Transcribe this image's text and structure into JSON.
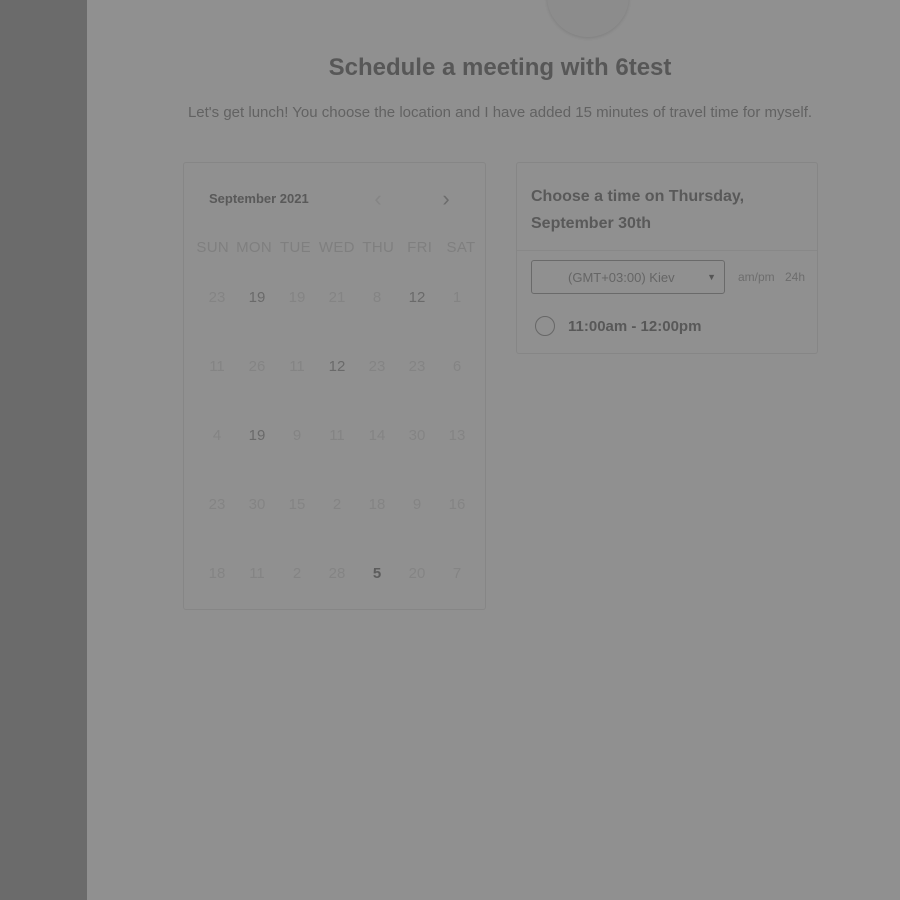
{
  "header": {
    "title": "Schedule a meeting with 6test",
    "subtitle": "Let's get lunch! You choose the location and I have added 15 minutes of travel time for myself."
  },
  "calendar": {
    "month_label": "September 2021",
    "prev_icon": "chevron-left-icon",
    "next_icon": "chevron-right-icon",
    "weekdays": [
      "SUN",
      "MON",
      "TUE",
      "WED",
      "THU",
      "FRI",
      "SAT"
    ],
    "weeks": [
      [
        "23",
        "19",
        "19",
        "21",
        "8",
        "12",
        "1"
      ],
      [
        "11",
        "26",
        "11",
        "12",
        "23",
        "23",
        "6"
      ],
      [
        "4",
        "19",
        "9",
        "11",
        "14",
        "30",
        "13"
      ],
      [
        "23",
        "30",
        "15",
        "2",
        "18",
        "9",
        "16"
      ],
      [
        "18",
        "11",
        "2",
        "28",
        "5",
        "20",
        "7"
      ]
    ]
  },
  "time_panel": {
    "heading": "Choose a time on Thursday, September 30th",
    "timezone": "(GMT+03:00) Kiev",
    "format_ampm": "am/pm",
    "format_24h": "24h",
    "slots": [
      {
        "label": "11:00am - 12:00pm"
      }
    ]
  }
}
